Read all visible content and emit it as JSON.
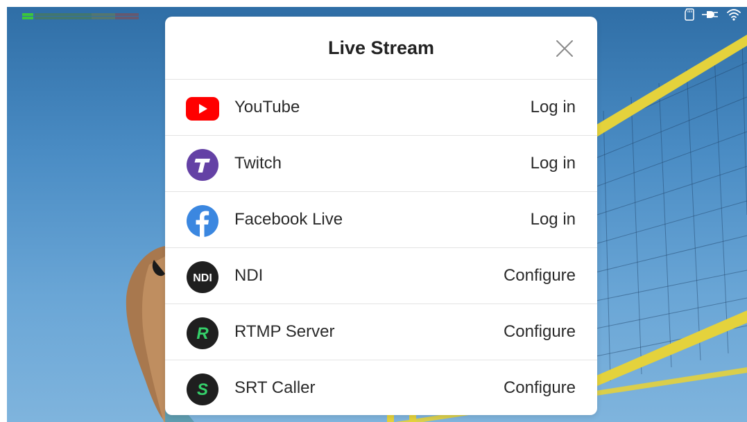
{
  "status_bar": {
    "icons": [
      "sd-card-icon",
      "power-plug-icon",
      "wifi-icon"
    ]
  },
  "modal": {
    "title": "Live Stream",
    "close_icon": "close-icon",
    "rows": [
      {
        "label": "YouTube",
        "action": "Log in",
        "icon": "youtube-icon",
        "color": "#ff0000"
      },
      {
        "label": "Twitch",
        "action": "Log in",
        "icon": "twitch-icon",
        "color": "#6441a5"
      },
      {
        "label": "Facebook Live",
        "action": "Log in",
        "icon": "facebook-icon",
        "color": "#3b87e0"
      },
      {
        "label": "NDI",
        "action": "Configure",
        "icon": "ndi-icon",
        "icon_text": "NDI",
        "color": "#1f1f1f"
      },
      {
        "label": "RTMP Server",
        "action": "Configure",
        "icon": "rtmp-icon",
        "icon_text": "R",
        "color": "#1f1f1f",
        "accent": "#35d06a"
      },
      {
        "label": "SRT Caller",
        "action": "Configure",
        "icon": "srt-icon",
        "icon_text": "S",
        "color": "#1f1f1f",
        "accent": "#35d06a"
      }
    ]
  }
}
